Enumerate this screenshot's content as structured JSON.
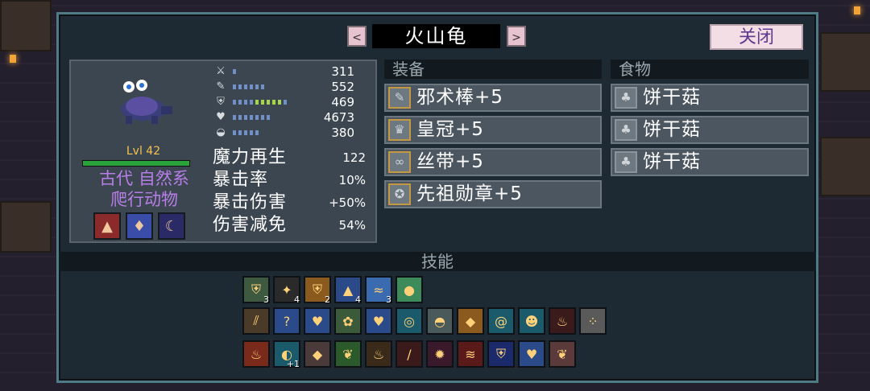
{
  "title": "火山龟",
  "close_label": "关闭",
  "nav": {
    "prev": "<",
    "next": ">"
  },
  "pet": {
    "level": "Lvl 42",
    "type_line1": "古代 自然系",
    "type_line2": "爬行动物",
    "stat_bars": [
      {
        "icon": "sword-icon",
        "value": "311",
        "level": 0.05
      },
      {
        "icon": "staff-icon",
        "value": "552",
        "level": 0.5
      },
      {
        "icon": "shield-icon",
        "value": "469",
        "level": 0.85
      },
      {
        "icon": "heart-icon",
        "value": "4673",
        "level": 0.55
      },
      {
        "icon": "boot-icon",
        "value": "380",
        "level": 0.45
      }
    ],
    "stats": [
      {
        "label": "魔力再生",
        "value": "122"
      },
      {
        "label": "暴击率",
        "value": "10%"
      },
      {
        "label": "暴击伤害",
        "value": "+50%"
      },
      {
        "label": "伤害减免",
        "value": "54%"
      }
    ],
    "traits": [
      {
        "icon": "red-hood-up-icon",
        "color": "#8a2a2a"
      },
      {
        "icon": "fire-shield-icon",
        "color": "#3a4da8"
      },
      {
        "icon": "moon-icon",
        "color": "#2a2a66"
      }
    ]
  },
  "sections": {
    "equipment": "装备",
    "food": "食物",
    "skills": "技能"
  },
  "equipment": [
    {
      "icon": "staff-icon",
      "label": "邪术棒+5"
    },
    {
      "icon": "crown-icon",
      "label": "皇冠+5"
    },
    {
      "icon": "ribbon-icon",
      "label": "丝带+5"
    },
    {
      "icon": "medal-icon",
      "label": "先祖勋章+5"
    }
  ],
  "food": [
    {
      "icon": "mushroom-icon",
      "label": "饼干菇"
    },
    {
      "icon": "mushroom-icon",
      "label": "饼干菇"
    },
    {
      "icon": "mushroom-icon",
      "label": "饼干菇"
    }
  ],
  "skills_row1": [
    {
      "icon": "green-shield-icon",
      "color": "#3d5a40",
      "count": "3"
    },
    {
      "icon": "sparks-icon",
      "color": "#2a2a2a",
      "count": "4"
    },
    {
      "icon": "gold-shield-icon",
      "color": "#8a5a1e",
      "count": "2"
    },
    {
      "icon": "ice-spikes-icon",
      "color": "#2a4a8a",
      "count": "4"
    },
    {
      "icon": "wind-icon",
      "color": "#3a6ab0",
      "count": "3"
    },
    {
      "icon": "rainbow-orb-icon",
      "color": "#3d8a5a",
      "count": ""
    }
  ],
  "skills_row2": [
    {
      "icon": "claw-icon",
      "color": "#4a3a28"
    },
    {
      "icon": "question-icon",
      "color": "#2a4a8a"
    },
    {
      "icon": "hearts-icon",
      "color": "#2a4a8a"
    },
    {
      "icon": "flower-icon",
      "color": "#3a5a3a"
    },
    {
      "icon": "heart-shield-icon",
      "color": "#2a4a8a"
    },
    {
      "icon": "ring-icon",
      "color": "#1a5a6a"
    },
    {
      "icon": "turtle-icon",
      "color": "#4a5a5a"
    },
    {
      "icon": "shield-gem-icon",
      "color": "#8a5a1e"
    },
    {
      "icon": "swirl-icon",
      "color": "#1a5a6a"
    },
    {
      "icon": "red-face-icon",
      "color": "#1a5a6a"
    },
    {
      "icon": "flame-icon",
      "color": "#3a1a1a"
    },
    {
      "icon": "dots-icon",
      "color": "#5a5a5a"
    }
  ],
  "skills_row3": [
    {
      "icon": "fire-demon-icon",
      "color": "#7a2a1a",
      "badge": ""
    },
    {
      "icon": "plus-one-icon",
      "color": "#1a5a6a",
      "badge": "+1"
    },
    {
      "icon": "red-gem-icon",
      "color": "#4a3a3a",
      "badge": ""
    },
    {
      "icon": "leaf-heart-icon",
      "color": "#2a5a2a",
      "badge": ""
    },
    {
      "icon": "flame-icon",
      "color": "#3a2a1a",
      "badge": ""
    },
    {
      "icon": "fire-staff-icon",
      "color": "#3a1a1a",
      "badge": ""
    },
    {
      "icon": "fire-burst-icon",
      "color": "#3a1a2a",
      "badge": ""
    },
    {
      "icon": "heat-wave-icon",
      "color": "#5a1a1a",
      "badge": ""
    },
    {
      "icon": "blue-shield-icon",
      "color": "#1a2a6a",
      "badge": ""
    },
    {
      "icon": "heart-shield-icon",
      "color": "#2a4a8a",
      "badge": ""
    },
    {
      "icon": "leaf-heart-icon",
      "color": "#5a3a3a",
      "badge": ""
    }
  ]
}
